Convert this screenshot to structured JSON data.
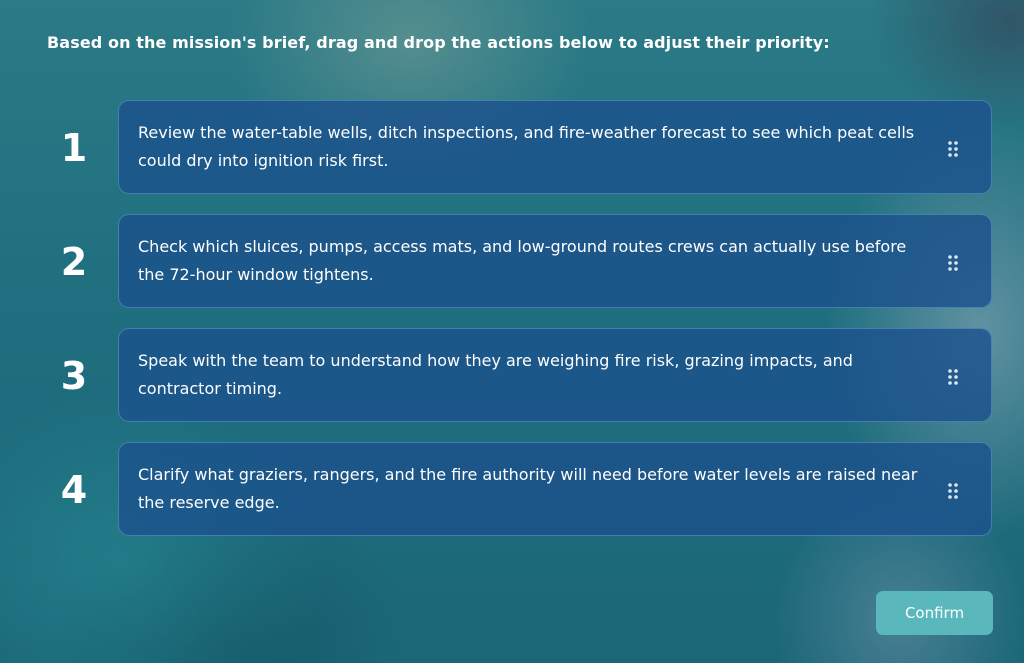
{
  "instruction": "Based on the mission's brief, drag and drop the actions below to adjust their priority:",
  "items": [
    {
      "number": "1",
      "text": "Review the water-table wells, ditch inspections, and fire-weather forecast to see which peat cells could dry into ignition risk first."
    },
    {
      "number": "2",
      "text": "Check which sluices, pumps, access mats, and low-ground routes crews can actually use before the 72-hour window tightens."
    },
    {
      "number": "3",
      "text": "Speak with the team to understand how they are weighing fire risk, grazing impacts, and contractor timing."
    },
    {
      "number": "4",
      "text": "Clarify what graziers, rangers, and the fire authority will need before water levels are raised near the reserve edge."
    }
  ],
  "confirm_label": "Confirm",
  "icons": {
    "drag_handle": "drag-handle-icon"
  },
  "colors": {
    "card_background": "#1c528c",
    "card_border": "#78afe1",
    "confirm_button": "#5ab8bd",
    "text": "#ffffff"
  }
}
